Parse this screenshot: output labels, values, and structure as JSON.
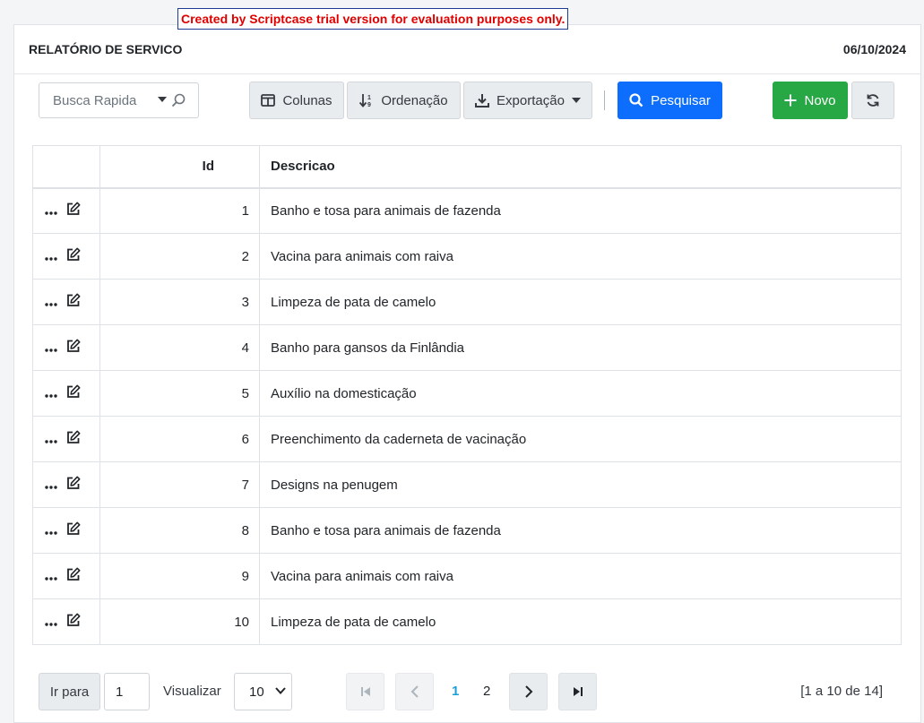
{
  "trial_notice": "Created by Scriptcase trial version for evaluation purposes only.",
  "header": {
    "title": "RELATÓRIO DE SERVICO",
    "date": "06/10/2024"
  },
  "toolbar": {
    "quick_search_placeholder": "Busca Rapida",
    "columns_label": "Colunas",
    "sort_label": "Ordenação",
    "export_label": "Exportação",
    "search_label": "Pesquisar",
    "new_label": "Novo"
  },
  "grid": {
    "columns": [
      "",
      "Id",
      "Descricao"
    ],
    "rows": [
      {
        "id": "1",
        "descricao": "Banho e tosa para animais de fazenda"
      },
      {
        "id": "2",
        "descricao": "Vacina para animais com raiva"
      },
      {
        "id": "3",
        "descricao": "Limpeza de pata de camelo"
      },
      {
        "id": "4",
        "descricao": "Banho para gansos da Finlândia"
      },
      {
        "id": "5",
        "descricao": "Auxílio na domesticação"
      },
      {
        "id": "6",
        "descricao": "Preenchimento da caderneta de vacinação"
      },
      {
        "id": "7",
        "descricao": "Designs na penugem"
      },
      {
        "id": "8",
        "descricao": "Banho e tosa para animais de fazenda"
      },
      {
        "id": "9",
        "descricao": "Vacina para animais com raiva"
      },
      {
        "id": "10",
        "descricao": "Limpeza de pata de camelo"
      }
    ]
  },
  "footer": {
    "goto_label": "Ir para",
    "goto_value": "1",
    "view_label": "Visualizar",
    "view_value": "10",
    "pages": [
      "1",
      "2"
    ],
    "current_page": "1",
    "range_text": "[1 a 10 de 14]"
  },
  "colors": {
    "primary": "#0d6efd",
    "success": "#28a745",
    "active_page": "#1aa0d8",
    "trial_text": "#e00000"
  },
  "icons": {
    "row_actions": [
      "more-icon",
      "edit-icon"
    ],
    "toolbar": [
      "columns-icon",
      "sort-icon",
      "download-icon",
      "search-icon",
      "plus-icon",
      "refresh-icon"
    ],
    "pagination": [
      "first-page-icon",
      "prev-page-icon",
      "next-page-icon",
      "last-page-icon"
    ]
  }
}
